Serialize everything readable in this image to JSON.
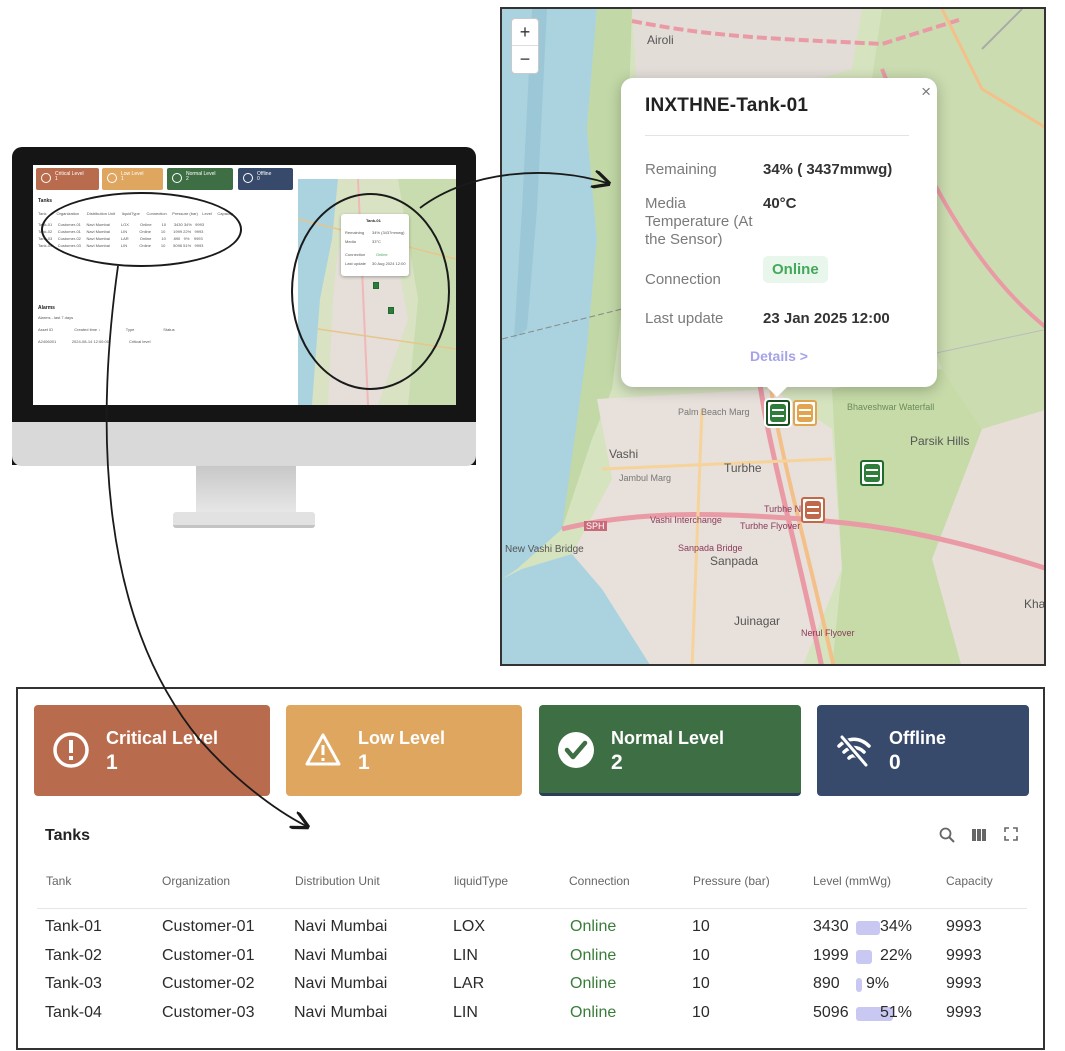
{
  "map": {
    "zoom_in": "+",
    "zoom_out": "−",
    "places": [
      "Airoli",
      "Vashi",
      "Turbhe",
      "Sanpada",
      "Juinagar",
      "Parsik Hills",
      "New Vashi Bridge",
      "Turbhe Naka",
      "Kharg"
    ],
    "roads": [
      "Vashi Interchange",
      "Turbhe Flyover",
      "Sanpada Bridge",
      "Nerul Flyover",
      "Jambul Marg",
      "SPH",
      "Palm Beach Marg",
      "Bhaveshwar Waterfall"
    ]
  },
  "popup": {
    "title": "INXTHNE-Tank-01",
    "close": "×",
    "remaining_label": "Remaining",
    "remaining_value": "34% ( 3437mmwg)",
    "media_label": "Media Temperature (At the Sensor)",
    "media_value": "40°C",
    "connection_label": "Connection",
    "connection_value": "Online",
    "last_update_label": "Last update",
    "last_update_value": "23 Jan 2025 12:00",
    "details": "Details >"
  },
  "cards": [
    {
      "title": "Critical Level",
      "count": "1",
      "color": "#b96b4d",
      "icon": "alert-circle-icon"
    },
    {
      "title": "Low Level",
      "count": "1",
      "color": "#dfa660",
      "icon": "warning-triangle-icon"
    },
    {
      "title": "Normal Level",
      "count": "2",
      "color": "#3e6f44",
      "icon": "check-circle-icon"
    },
    {
      "title": "Offline",
      "count": "0",
      "color": "#374a6b",
      "icon": "wifi-off-icon"
    }
  ],
  "tanks": {
    "title": "Tanks",
    "tools": {
      "search": "🔍",
      "columns": "▥",
      "fullscreen": "⛶"
    },
    "columns": [
      "Tank",
      "Organization",
      "Distribution Unit",
      "liquidType",
      "Connection",
      "Pressure (bar)",
      "Level (mmWg)",
      "Capacity"
    ],
    "rows": [
      {
        "tank": "Tank-01",
        "org": "Customer-01",
        "unit": "Navi Mumbai",
        "liquid": "LOX",
        "conn": "Online",
        "pressure": "10",
        "level": "3430",
        "pct": "34%",
        "pct_num": 0.34,
        "capacity": "9993"
      },
      {
        "tank": "Tank-02",
        "org": "Customer-01",
        "unit": "Navi Mumbai",
        "liquid": "LIN",
        "conn": "Online",
        "pressure": "10",
        "level": "1999",
        "pct": "22%",
        "pct_num": 0.22,
        "capacity": "9993"
      },
      {
        "tank": "Tank-03",
        "org": "Customer-02",
        "unit": "Navi Mumbai",
        "liquid": "LAR",
        "conn": "Online",
        "pressure": "10",
        "level": "890",
        "pct": "9%",
        "pct_num": 0.09,
        "capacity": "9993"
      },
      {
        "tank": "Tank-04",
        "org": "Customer-03",
        "unit": "Navi Mumbai",
        "liquid": "LIN",
        "conn": "Online",
        "pressure": "10",
        "level": "5096",
        "pct": "51%",
        "pct_num": 0.51,
        "capacity": "9993"
      }
    ]
  },
  "mini": {
    "cards": [
      "Critical Level",
      "Low Level",
      "Normal Level",
      "Offline"
    ],
    "counts": [
      "1",
      "1",
      "2",
      "0"
    ],
    "tanks_title": "Tanks",
    "alarms_title": "Alarms",
    "alarms_filter": "Alarms - last 7 days",
    "alarm_row": "2024-08-14 12:00:00",
    "alarm_type": "Critical level",
    "popup_title": "Tank-01",
    "popup_remaining": "34% (3437mmwg)",
    "popup_temp": "33°C",
    "popup_conn": "Online",
    "popup_update": "30 Aug 2024 12:00"
  }
}
